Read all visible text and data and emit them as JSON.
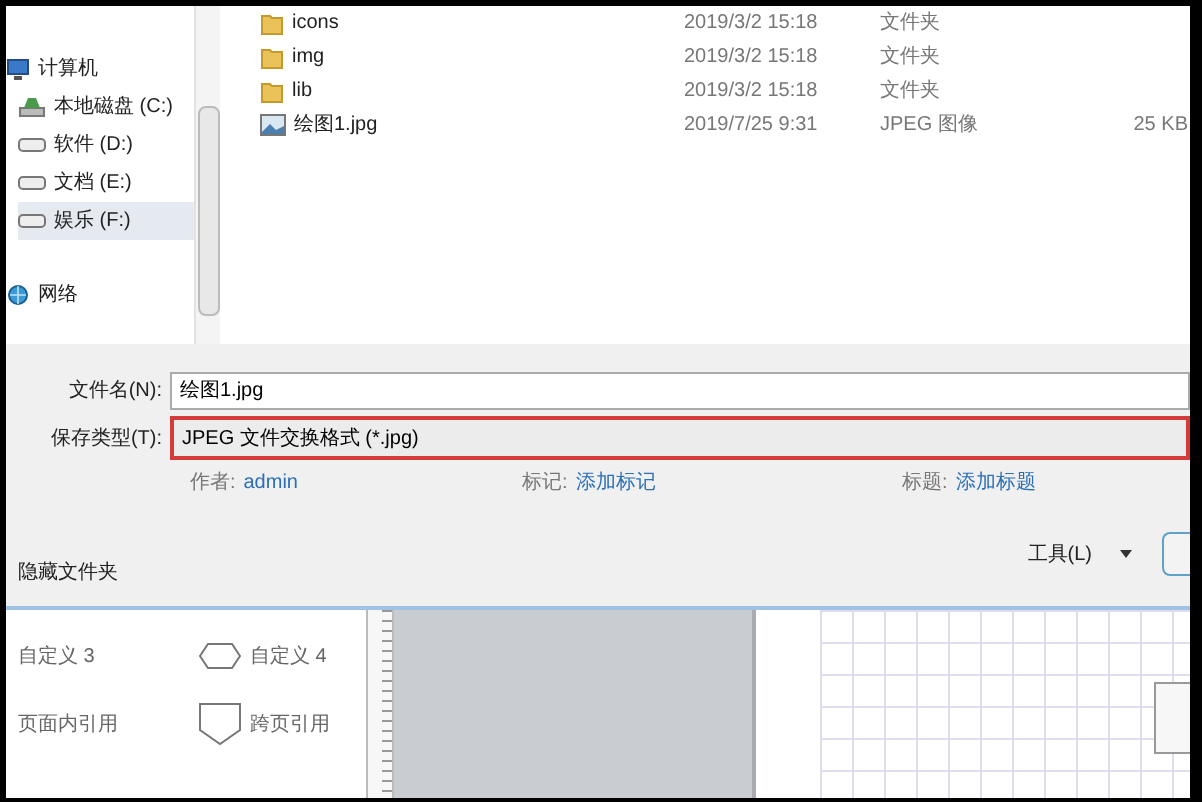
{
  "nav": {
    "items": [
      {
        "label": "计算机",
        "kind": "computer",
        "selected": false,
        "children": [
          {
            "label": "本地磁盘 (C:)",
            "kind": "system-drive",
            "selected": false
          },
          {
            "label": "软件 (D:)",
            "kind": "drive",
            "selected": false
          },
          {
            "label": "文档 (E:)",
            "kind": "drive",
            "selected": false
          },
          {
            "label": "娱乐 (F:)",
            "kind": "drive",
            "selected": true
          }
        ]
      },
      {
        "label": "网络",
        "kind": "network",
        "selected": false
      }
    ]
  },
  "files": [
    {
      "name": "icons",
      "kind": "folder",
      "modified": "2019/3/2 15:18",
      "type": "文件夹"
    },
    {
      "name": "img",
      "kind": "folder",
      "modified": "2019/3/2 15:18",
      "type": "文件夹"
    },
    {
      "name": "lib",
      "kind": "folder",
      "modified": "2019/3/2 15:18",
      "type": "文件夹"
    },
    {
      "name": "绘图1.jpg",
      "kind": "image",
      "modified": "2019/7/25 9:31",
      "type": "JPEG 图像",
      "size": "25 KB"
    }
  ],
  "file_name": {
    "label": "文件名(N):",
    "value": "绘图1.jpg"
  },
  "save_type": {
    "label": "保存类型(T):",
    "value": "JPEG 文件交换格式 (*.jpg)",
    "highlighted": true
  },
  "meta": [
    {
      "label": "作者:",
      "value": "admin"
    },
    {
      "label": "标记:",
      "value": "添加标记"
    },
    {
      "label": "标题:",
      "value": "添加标题"
    }
  ],
  "hide_folders": "隐藏文件夹",
  "tools": "工具(L)",
  "shapes": [
    {
      "label": "自定义 3",
      "kind": "none"
    },
    {
      "label": "自定义 4",
      "kind": "hexagon"
    },
    {
      "label": "页面内引用",
      "kind": "none"
    },
    {
      "label": "跨页引用",
      "kind": "pentagon"
    }
  ]
}
